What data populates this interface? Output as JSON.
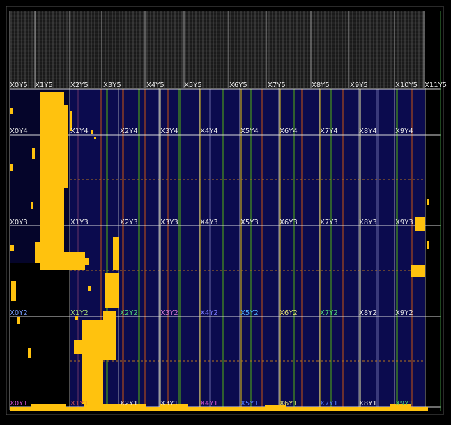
{
  "view": "fpga-device-floorplan",
  "colors": {
    "background": "#000000",
    "fabric": "#0b0b4e",
    "placed_logic": "#ffc20e",
    "clock_region_line": "#d9d9d9",
    "top_tiles": "#6f6f6f"
  },
  "clock_regions": {
    "row5": [
      "X0Y5",
      "X1Y5",
      "X2Y5",
      "X3Y5",
      "X4Y5",
      "X5Y5",
      "X6Y5",
      "X7Y5",
      "X8Y5",
      "X9Y5",
      "X10Y5",
      "X11Y5"
    ],
    "row4": [
      "X0Y4",
      "X1Y4",
      "X2Y4",
      "X3Y4",
      "X4Y4",
      "X5Y4",
      "X6Y4",
      "X7Y4",
      "X8Y4",
      "X9Y4"
    ],
    "row3": [
      "X0Y3",
      "X1Y3",
      "X2Y3",
      "X3Y3",
      "X4Y3",
      "X5Y3",
      "X6Y3",
      "X7Y3",
      "X8Y3",
      "X9Y3"
    ],
    "row2": [
      "X0Y2",
      "X1Y2",
      "X2Y2",
      "X3Y2",
      "X4Y2",
      "X5Y2",
      "X6Y2",
      "X7Y2",
      "X8Y2",
      "X9Y2"
    ],
    "row1": [
      "X0Y1",
      "X1Y1",
      "X2Y1",
      "X3Y1",
      "X4Y1",
      "X5Y1",
      "X6Y1",
      "X7Y1",
      "X8Y1",
      "X9Y1"
    ]
  }
}
